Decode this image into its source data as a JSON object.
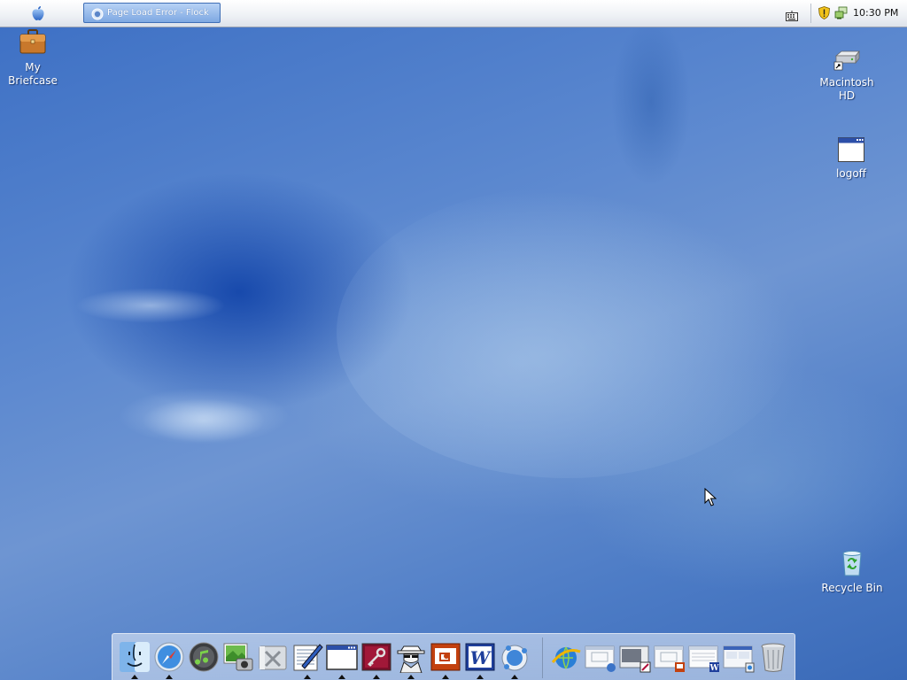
{
  "taskbar": {
    "window_title": "Page Load Error - Flock",
    "clock": "10:30 PM"
  },
  "desktop_icons": {
    "briefcase": "My\nBriefcase",
    "macintosh_hd": "Macintosh\nHD",
    "logoff": "logoff",
    "recycle_bin": "Recycle Bin"
  },
  "dock": {
    "apps": [
      "finder-icon",
      "safari-icon",
      "itunes-icon",
      "iphoto-icon",
      "system-tools-icon",
      "text-editor-icon",
      "blank-window-icon",
      "key-app-icon",
      "spy-app-icon",
      "powerpoint-icon",
      "word-icon",
      "network-globe-icon"
    ],
    "minimized": [
      "internet-explorer-icon",
      "window-thumbnail-1-icon",
      "window-thumbnail-2-icon",
      "window-thumbnail-3-icon",
      "window-thumbnail-4-icon",
      "window-thumbnail-5-icon",
      "trash-icon"
    ]
  },
  "colors": {
    "desktop_blue": "#4d7cc6",
    "taskbar_active": "#7ea8e2"
  }
}
